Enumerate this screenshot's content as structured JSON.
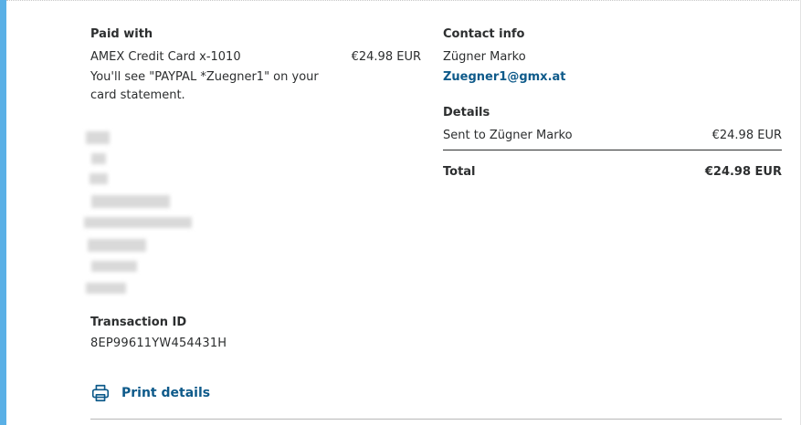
{
  "paid_with": {
    "heading": "Paid with",
    "card": "AMEX Credit Card x-1010",
    "amount": "€24.98 EUR",
    "statement_note": "You'll see \"PAYPAL *Zuegner1\" on your card statement."
  },
  "transaction": {
    "heading": "Transaction ID",
    "id": "8EP99611YW454431H"
  },
  "print": {
    "label": "Print details",
    "icon": "printer-icon"
  },
  "contact": {
    "heading": "Contact info",
    "name": "Zügner Marko",
    "email": "Zuegner1@gmx.at"
  },
  "details": {
    "heading": "Details",
    "sent_label": "Sent to Zügner Marko",
    "sent_amount": "€24.98 EUR",
    "total_label": "Total",
    "total_amount": "€24.98 EUR"
  },
  "colors": {
    "link": "#0e5a8a",
    "accent": "#5ab0e6",
    "text": "#2c2e2f"
  }
}
